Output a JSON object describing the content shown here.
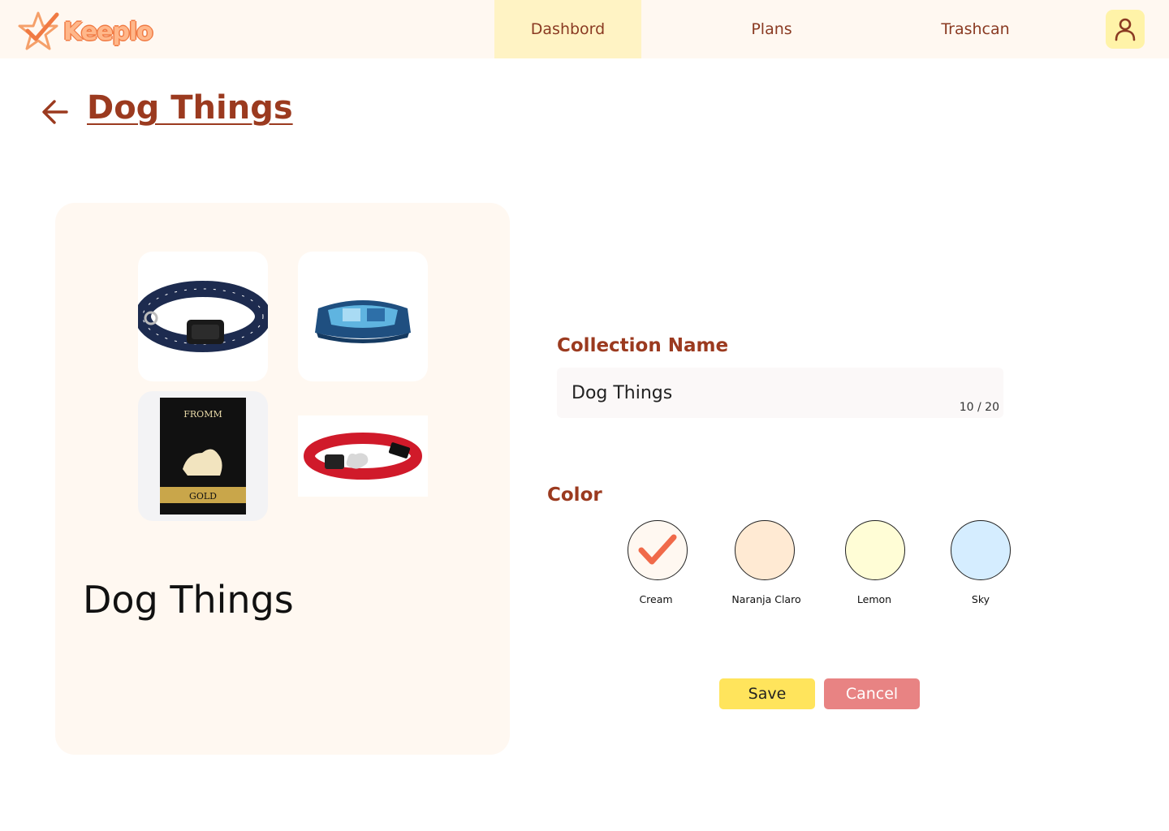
{
  "app": {
    "logo_text": "Keeplo"
  },
  "nav": {
    "tabs": [
      {
        "label": "Dashbord",
        "active": true
      },
      {
        "label": "Plans",
        "active": false
      },
      {
        "label": "Trashcan",
        "active": false
      }
    ],
    "user_icon": "user-icon"
  },
  "page": {
    "title": "Dog Things",
    "back_icon": "arrow-left-icon"
  },
  "preview": {
    "name": "Dog Things",
    "items": [
      {
        "kind": "dog collar with anchor pattern"
      },
      {
        "kind": "blue patchwork dog bed"
      },
      {
        "kind": "dog food bag",
        "brand_text": "FROMM",
        "label_text": "GOLD"
      },
      {
        "kind": "red dog collar"
      }
    ]
  },
  "form": {
    "name_label": "Collection Name",
    "name_value": "Dog Things",
    "counter": "10 / 20",
    "color_label": "Color",
    "colors": [
      {
        "label": "Cream",
        "hex": "#fff8f1",
        "selected": true
      },
      {
        "label": "Naranja Claro",
        "hex": "#ffead3",
        "selected": false
      },
      {
        "label": "Lemon",
        "hex": "#fffdd6",
        "selected": false
      },
      {
        "label": "Sky",
        "hex": "#d5edff",
        "selected": false
      }
    ],
    "save_label": "Save",
    "cancel_label": "Cancel"
  },
  "colors": {
    "accent": "#9b3a1f",
    "check": "#f06a4a",
    "save": "#ffe45c",
    "cancel": "#e88383"
  }
}
